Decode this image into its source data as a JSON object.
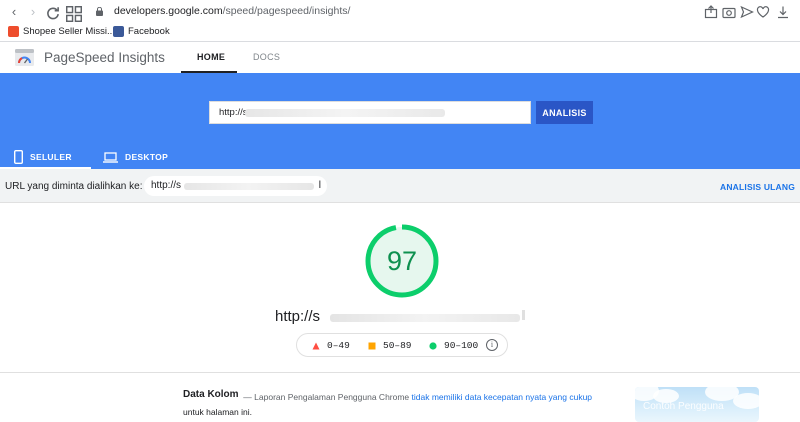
{
  "browser": {
    "url_domain": "developers.google.com",
    "url_path": "/speed/pagespeed/insights/",
    "bookmarks": [
      {
        "label": "Shopee Seller Missi..."
      },
      {
        "label": "Facebook"
      }
    ]
  },
  "header": {
    "title": "PageSpeed Insights",
    "tabs": [
      {
        "label": "HOME"
      },
      {
        "label": "DOCS"
      }
    ]
  },
  "hero": {
    "url_value": "http://s",
    "analyze_label": "ANALISIS",
    "device_tabs": [
      {
        "label": "SELULER"
      },
      {
        "label": "DESKTOP"
      }
    ]
  },
  "redirect": {
    "label": "URL yang diminta dialihkan ke:",
    "url": "http://s",
    "url_end": "l",
    "reanalyze_label": "ANALISIS ULANG"
  },
  "score": {
    "value": "97",
    "fraction": 0.97,
    "tested_url": "http://s",
    "legend": [
      {
        "range": "0–49",
        "color": "#ff4e42"
      },
      {
        "range": "50–89",
        "color": "#ffa400"
      },
      {
        "range": "90–100",
        "color": "#0cce6b"
      }
    ],
    "info_glyph": "i"
  },
  "field_data": {
    "title": "Data Kolom",
    "text_before": "— Laporan Pengalaman Pengguna Chrome ",
    "link_text": "tidak memiliki data kecepatan nyata yang cukup",
    "text_after": " untuk halaman ini.",
    "thumbnail_caption": "Contoh Pengguna"
  },
  "colors": {
    "hero_blue": "#4285f4",
    "button_blue": "#2a56c6",
    "score_green": "#0cce6b",
    "link_blue": "#1a73e8"
  }
}
